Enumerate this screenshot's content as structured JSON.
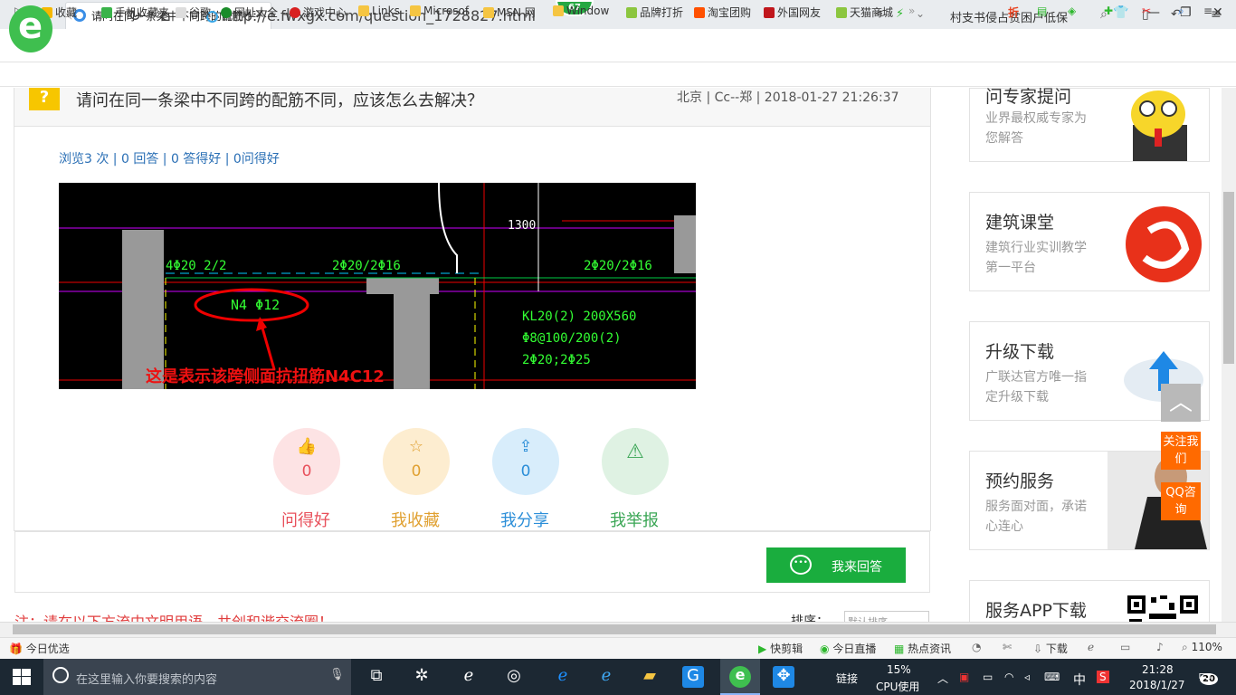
{
  "browser": {
    "tab_title": "请问在同一条梁中不同跨的配筋不",
    "badge_count": "67",
    "url": "http://e.fwxgx.com/question_1728827.html",
    "search_text": "村支书侵占贫困户低保",
    "bookmarks": [
      "收藏",
      "手机收藏夹",
      "谷歌",
      "网址大全",
      "游戏中心",
      "Links",
      "Microsof",
      "MSN 网",
      "Window",
      "品牌打折",
      "淘宝团购",
      "外国网友",
      "天猫商城"
    ]
  },
  "question": {
    "icon": "?",
    "title": "请问在同一条梁中不同跨的配筋不同，应该怎么去解决？",
    "meta": "北京 | Cc--郑 | 2018-01-27 21:26:37",
    "stats": "浏览3 次 | 0 回答 | 0 答得好 | 0问得好",
    "cad": {
      "labels": [
        "4Φ20 2/2",
        "2Φ20/2Φ16",
        "2Φ20/2Φ16",
        "N4 Φ12",
        "KL20(2) 200X560",
        "Φ8@100/200(2)",
        "2Φ20;2Φ25",
        "1300"
      ],
      "annotation": "这是表示该跨侧面抗扭筋N4C12"
    },
    "actions": [
      {
        "label": "问得好",
        "count": "0",
        "icon": "thumbs-up-icon",
        "color": "#e8505b",
        "bg": "#fde3e4"
      },
      {
        "label": "我收藏",
        "count": "0",
        "icon": "star-icon",
        "color": "#e0a030",
        "bg": "#fdedd0"
      },
      {
        "label": "我分享",
        "count": "0",
        "icon": "share-icon",
        "color": "#2b8ed8",
        "bg": "#d8edfb"
      },
      {
        "label": "我举报",
        "count": "",
        "icon": "warning-icon",
        "color": "#3aa655",
        "bg": "#dff2e3"
      }
    ],
    "answer_button": "我来回答",
    "note": "注：请在以下方流中文明用语，共创和谐交流圈！",
    "sort_label": "排序：",
    "sort_value": "默认排序"
  },
  "sidebar": {
    "cards": [
      {
        "title": "问专家提问",
        "desc": "业界最权威专家为您解答"
      },
      {
        "title": "建筑课堂",
        "desc": "建筑行业实训教学第一平台"
      },
      {
        "title": "升级下载",
        "desc": "广联达官方唯一指定升级下载"
      },
      {
        "title": "预约服务",
        "desc": "服务面对面，承诺心连心"
      },
      {
        "title": "服务APP下载",
        "desc": ""
      }
    ],
    "follow": "关注我们",
    "qq": "QQ咨询"
  },
  "statusbar": {
    "left": "今日优选",
    "items": [
      "快剪辑",
      "今日直播",
      "热点资讯",
      "下载"
    ],
    "zoom": "110%"
  },
  "taskbar": {
    "search_placeholder": "在这里输入你要搜索的内容",
    "link_label": "链接",
    "cpu_percent": "15%",
    "cpu_label": "CPU使用",
    "ime": "中",
    "time": "21:28",
    "date": "2018/1/27",
    "notif_count": "20"
  }
}
